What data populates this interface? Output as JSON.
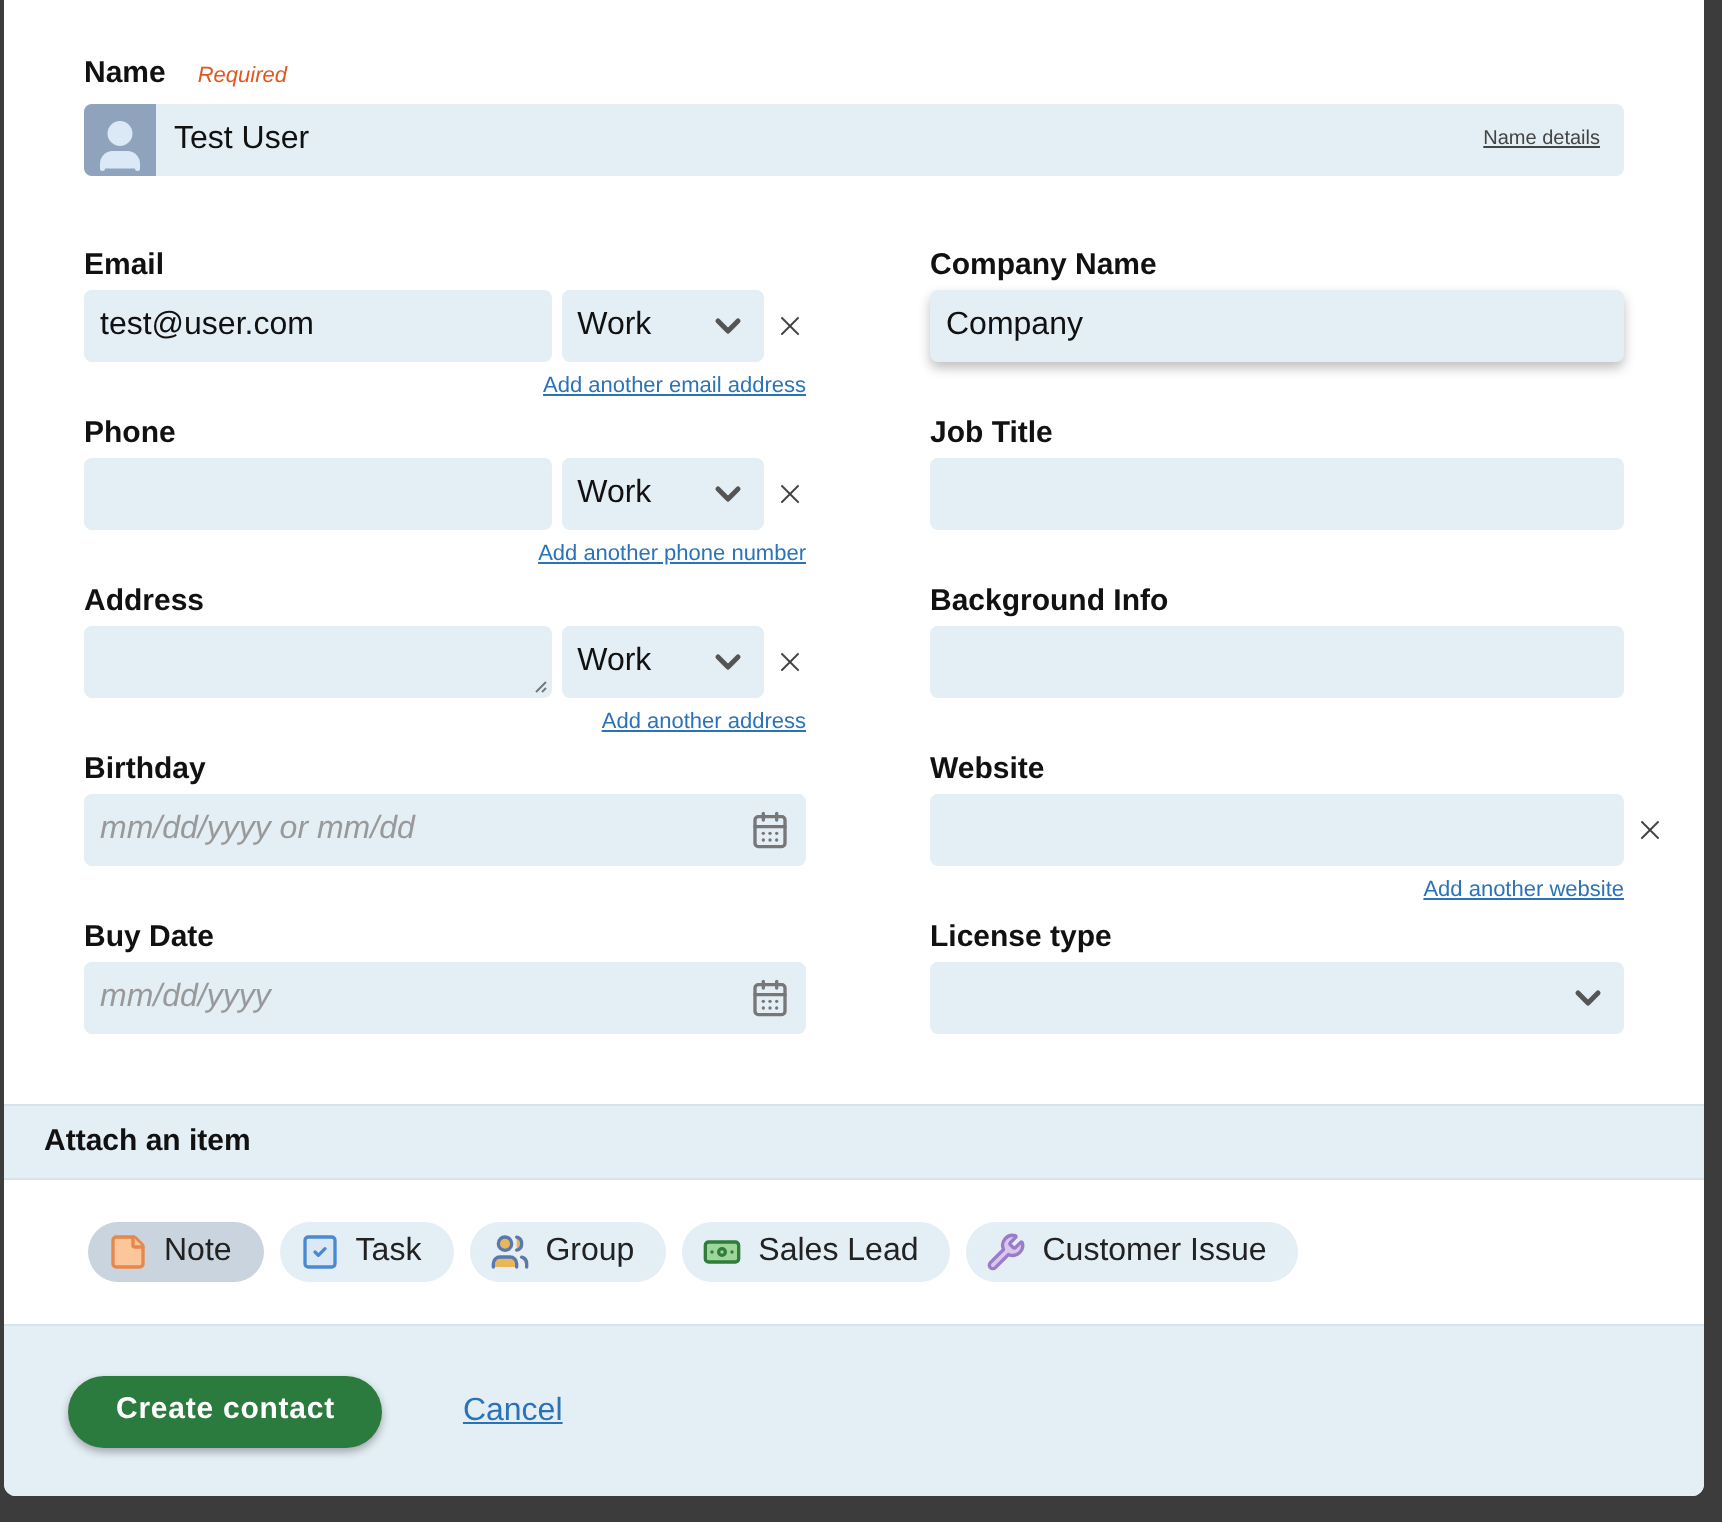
{
  "name_field": {
    "label": "Name",
    "required": "Required",
    "value": "Test User",
    "details_link": "Name details"
  },
  "left_fields": [
    {
      "kind": "typed",
      "label": "Email",
      "value": "test@user.com",
      "type": "Work",
      "link": "Add another email address"
    },
    {
      "kind": "typed",
      "label": "Phone",
      "type": "Work",
      "link": "Add another phone number"
    },
    {
      "kind": "multiline",
      "label": "Address",
      "type": "Work",
      "link": "Add another address"
    },
    {
      "kind": "date",
      "label": "Birthday",
      "placeholder": "mm/dd/yyyy or mm/dd"
    },
    {
      "kind": "date",
      "label": "Buy Date",
      "placeholder": "mm/dd/yyyy"
    }
  ],
  "right_fields": [
    {
      "kind": "text",
      "label": "Company Name",
      "value": "Company",
      "focused": true
    },
    {
      "kind": "text",
      "label": "Job Title",
      "focused": false
    },
    {
      "kind": "text",
      "label": "Background Info",
      "focused": false
    },
    {
      "kind": "removable",
      "label": "Website",
      "link": "Add another website"
    },
    {
      "kind": "select",
      "label": "License type"
    }
  ],
  "attach": {
    "title": "Attach an item",
    "items": [
      {
        "kind": "note",
        "label": "Note",
        "selected": true
      },
      {
        "kind": "task",
        "label": "Task",
        "selected": false
      },
      {
        "kind": "group",
        "label": "Group",
        "selected": false
      },
      {
        "kind": "lead",
        "label": "Sales Lead",
        "selected": false
      },
      {
        "kind": "issue",
        "label": "Customer Issue",
        "selected": false
      }
    ]
  },
  "footer": {
    "primary": "Create contact",
    "cancel": "Cancel"
  }
}
